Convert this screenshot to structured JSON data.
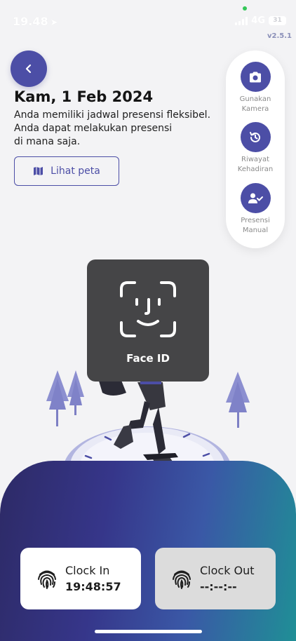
{
  "status_bar": {
    "time": "19.48",
    "location_icon": "location-arrow-icon",
    "network": "4G",
    "battery": "31"
  },
  "app_version": "v2.5.1",
  "header": {
    "back_icon": "chevron-left-icon",
    "date": "Kam, 1 Feb 2024",
    "schedule_lines": [
      "Anda memiliki jadwal presensi fleksibel.",
      "Anda dapat melakukan presensi",
      "di mana saja."
    ],
    "map_button": {
      "icon": "map-icon",
      "label": "Lihat peta"
    }
  },
  "side_menu": [
    {
      "icon": "camera-icon",
      "label_lines": [
        "Gunakan",
        "Kamera"
      ]
    },
    {
      "icon": "history-icon",
      "label_lines": [
        "Riwayat",
        "Kehadiran"
      ]
    },
    {
      "icon": "user-check-icon",
      "label_lines": [
        "Presensi",
        "Manual"
      ]
    }
  ],
  "face_id": {
    "icon": "face-id-icon",
    "label": "Face ID"
  },
  "clock_in": {
    "icon": "fingerprint-icon",
    "label": "Clock In",
    "time": "19:48:57"
  },
  "clock_out": {
    "icon": "fingerprint-icon",
    "label": "Clock Out",
    "time": "--:--:--"
  },
  "colors": {
    "primary": "#4c4ea6",
    "panel_gradient_start": "#2d2a66",
    "panel_gradient_end": "#1f8f96",
    "background": "#f3f3f5"
  }
}
